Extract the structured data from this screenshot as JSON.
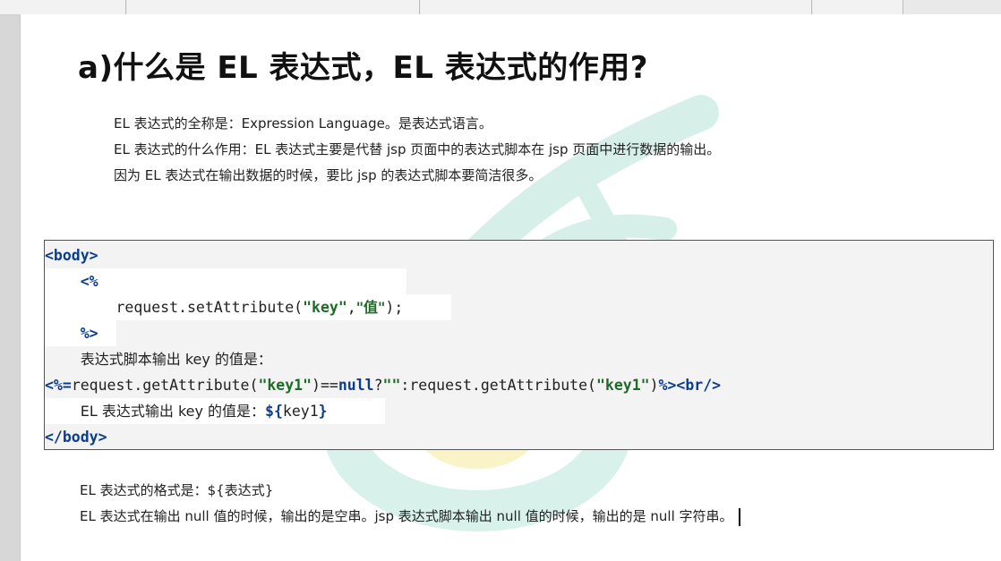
{
  "title": "a)什么是 EL 表达式，EL 表达式的作用?",
  "intro": {
    "line1": "EL 表达式的全称是：Expression Language。是表达式语言。",
    "line2": "EL 表达式的什么作用：EL 表达式主要是代替 jsp 页面中的表达式脚本在 jsp 页面中进行数据的输出。",
    "line3": "因为 EL 表达式在输出数据的时候，要比 jsp 的表达式脚本要简洁很多。"
  },
  "code": {
    "body_open": "<body>",
    "scriptlet_open": "<%",
    "set_prefix": "request.setAttribute(",
    "set_key": "\"key\"",
    "set_comma": ",",
    "set_value": "\"值\"",
    "set_suffix": ");",
    "scriptlet_close": "%>",
    "label_script": "表达式脚本输出 key 的值是：",
    "expr_open": "<%=",
    "expr_get1": "request.getAttribute(",
    "expr_key1a": "\"key1\"",
    "expr_eq": ")==",
    "expr_null": "null",
    "expr_q": "?",
    "expr_empty": "\"\"",
    "expr_colon": ":request.getAttribute(",
    "expr_key1b": "\"key1\"",
    "expr_close_paren": ")",
    "expr_close": "%>",
    "br_tag": "<br/>",
    "label_el": "EL 表达式输出 key 的值是：",
    "el_open": "${",
    "el_key": "key1",
    "el_close": "}",
    "body_close": "</body>"
  },
  "notes": {
    "line1": "EL 表达式的格式是：${表达式}",
    "line2": "EL 表达式在输出 null 值的时候，输出的是空串。jsp 表达式脚本输出 null 值的时候，输出的是 null 字符串。"
  },
  "colors": {
    "tag": "#0b3d8f",
    "string": "#1e6b27",
    "code_bg": "#f3f3f3",
    "watermark_green": "#cfeee6",
    "watermark_yellow": "#fbf0bf"
  }
}
